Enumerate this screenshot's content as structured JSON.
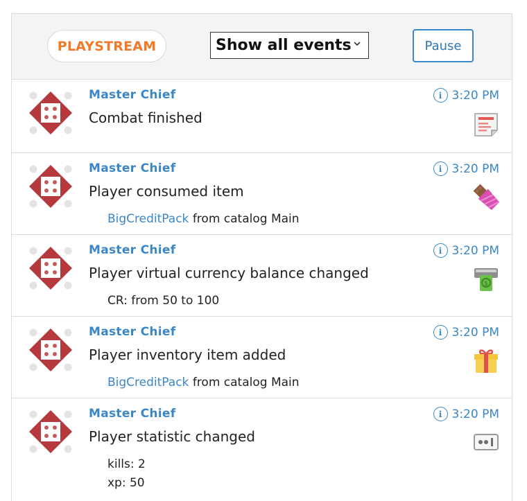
{
  "header": {
    "badge": "PLAYSTREAM",
    "filter_value": "Show all events",
    "pause_label": "Pause"
  },
  "events": [
    {
      "player": "Master Chief",
      "time": "3:20 PM",
      "title": "Combat finished",
      "icon": "report-icon"
    },
    {
      "player": "Master Chief",
      "time": "3:20 PM",
      "title": "Player consumed item",
      "icon": "candy-bar-icon",
      "detail": {
        "item": "BigCreditPack",
        "text": "from catalog Main"
      }
    },
    {
      "player": "Master Chief",
      "time": "3:20 PM",
      "title": "Player virtual currency balance changed",
      "icon": "cash-register-icon",
      "detail_line": "CR: from 50 to 100"
    },
    {
      "player": "Master Chief",
      "time": "3:20 PM",
      "title": "Player inventory item added",
      "icon": "gift-icon",
      "detail": {
        "item": "BigCreditPack",
        "text": "from catalog Main"
      }
    },
    {
      "player": "Master Chief",
      "time": "3:20 PM",
      "title": "Player statistic changed",
      "icon": "statistic-icon",
      "stats": [
        "kills: 2",
        "xp: 50"
      ]
    }
  ],
  "colors": {
    "accent": "#3b86c6",
    "badge": "#f07a2a",
    "avatar": "#b5393d"
  }
}
